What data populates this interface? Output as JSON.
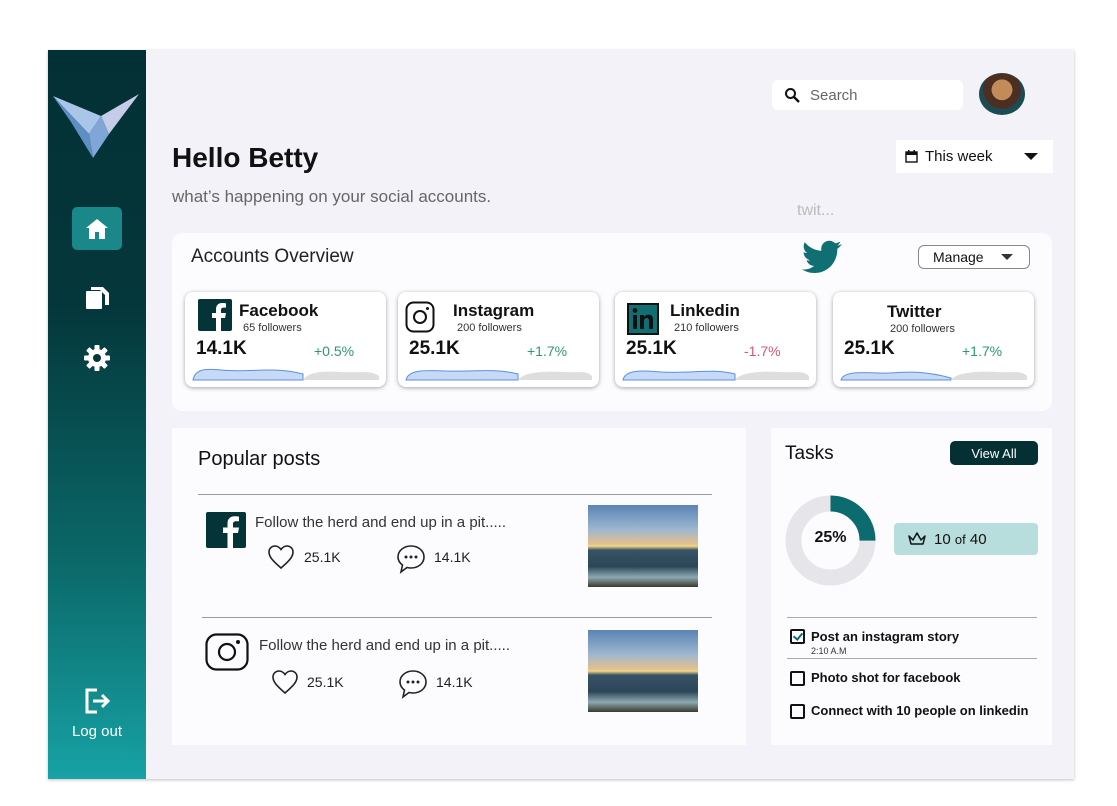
{
  "header": {
    "search_placeholder": "Search",
    "greeting": "Hello Betty",
    "subtitle": "what’s happening on your social accounts.",
    "date_range": "This week",
    "ghost_text": "twit..."
  },
  "sidebar": {
    "items": [
      {
        "name": "home",
        "icon": "home-icon",
        "active": true
      },
      {
        "name": "documents",
        "icon": "documents-icon",
        "active": false
      },
      {
        "name": "settings",
        "icon": "gear-icon",
        "active": false
      }
    ],
    "logout_label": "Log out"
  },
  "overview": {
    "title": "Accounts Overview",
    "manage_label": "Manage",
    "accounts": [
      {
        "name": "Facebook",
        "followers": "65 followers",
        "value": "14.1K",
        "change": "+0.5%",
        "trend": "up"
      },
      {
        "name": "Instagram",
        "followers": "200 followers",
        "value": "25.1K",
        "change": "+1.7%",
        "trend": "up"
      },
      {
        "name": "Linkedin",
        "followers": "210 followers",
        "value": "25.1K",
        "change": "-1.7%",
        "trend": "down"
      },
      {
        "name": "Twitter",
        "followers": "200 followers",
        "value": "25.1K",
        "change": "+1.7%",
        "trend": "up"
      }
    ]
  },
  "popular": {
    "title": "Popular posts",
    "posts": [
      {
        "platform": "facebook",
        "text": "Follow the herd and end up in a pit.....",
        "likes": "25.1K",
        "comments": "14.1K"
      },
      {
        "platform": "instagram",
        "text": "Follow the herd and end up in a pit.....",
        "likes": "25.1K",
        "comments": "14.1K"
      }
    ]
  },
  "tasks": {
    "title": "Tasks",
    "view_all_label": "View All",
    "progress_label": "25%",
    "progress_fraction": 0.25,
    "count_done": "10",
    "count_of": "of",
    "count_total": "40",
    "items": [
      {
        "label": "Post an instagram story",
        "time": "2:10 A.M",
        "done": true
      },
      {
        "label": "Photo shot for facebook",
        "time": "",
        "done": false
      },
      {
        "label": "Connect with 10 people on linkedin",
        "time": "",
        "done": false
      }
    ]
  },
  "colors": {
    "sidebar_dark": "#033035",
    "sidebar_light": "#17a2a5",
    "accent": "#0d6d70",
    "positive": "#2e9a6c",
    "negative": "#d4587a",
    "badge_bg": "#b7dedc"
  }
}
